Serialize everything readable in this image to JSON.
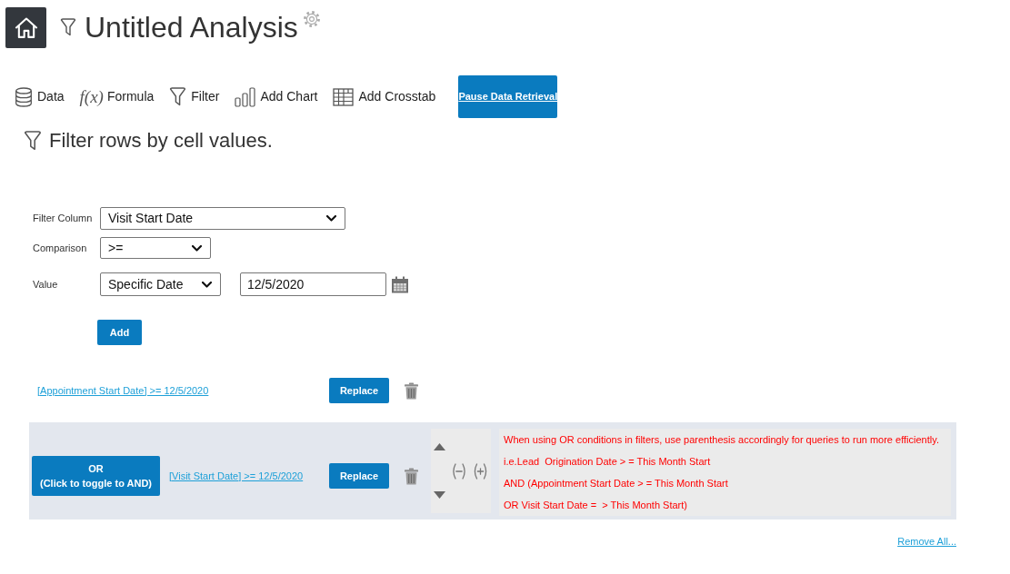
{
  "header": {
    "title": "Untitled Analysis"
  },
  "toolbar": {
    "items": [
      {
        "kind": "data",
        "label": "Data"
      },
      {
        "kind": "formula",
        "icon": "f(x)",
        "label": "Formula"
      },
      {
        "kind": "filter",
        "label": "Filter"
      },
      {
        "kind": "chart",
        "label": "Add Chart"
      },
      {
        "kind": "crosstab",
        "label": "Add Crosstab"
      }
    ],
    "pause_button": "Pause Data Retrieval"
  },
  "filter_panel": {
    "heading": "Filter rows by cell values.",
    "form": {
      "filter_column": {
        "label": "Filter Column",
        "value": "Visit Start Date"
      },
      "comparison": {
        "label": "Comparison",
        "value": ">="
      },
      "value": {
        "label": "Value",
        "mode": "Specific Date",
        "date": "12/5/2020"
      },
      "add_button": "Add"
    },
    "filters": [
      {
        "selected": false,
        "expression": "[Appointment Start Date] >= 12/5/2020",
        "replace_button": "Replace"
      },
      {
        "selected": true,
        "connector": {
          "label": "OR",
          "hint": "(Click to toggle to AND)"
        },
        "expression": "[Visit Start Date] >= 12/5/2020",
        "replace_button": "Replace",
        "note": [
          "When using OR conditions in filters, use parenthesis accordingly for queries to run more efficiently.",
          "i.e.Lead  Origination Date > = This Month Start",
          "AND (Appointment Start Date > = This Month Start",
          "OR Visit Start Date =  > This Month Start)"
        ]
      }
    ],
    "remove_all": "Remove All..."
  }
}
